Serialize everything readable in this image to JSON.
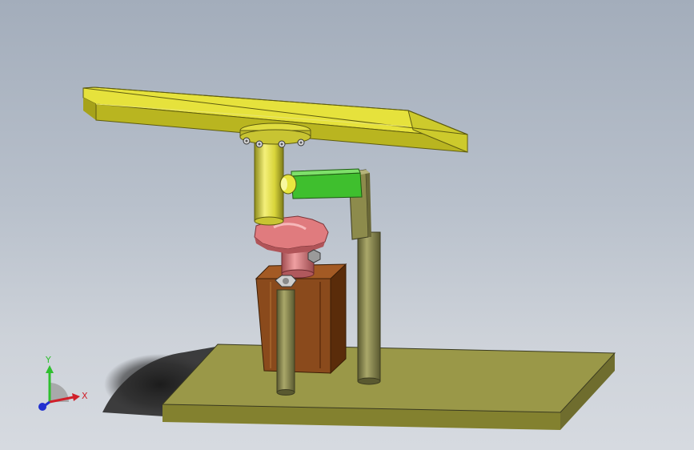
{
  "viewport": {
    "background_top": "#a3adbb",
    "background_bottom": "#d6dae0"
  },
  "model": {
    "parts": [
      {
        "name": "base-plate",
        "color": "#9a9848"
      },
      {
        "name": "top-platform",
        "color": "#e6e23c"
      },
      {
        "name": "flange-mount",
        "color": "#e0dc40"
      },
      {
        "name": "vertical-cylinder",
        "color": "#e6e23c"
      },
      {
        "name": "green-link-arm",
        "color": "#3fbf2e"
      },
      {
        "name": "side-support-post",
        "color": "#8d8b4c"
      },
      {
        "name": "star-knob",
        "color": "#e07b7e"
      },
      {
        "name": "motor-housing",
        "color": "#7a3f14"
      },
      {
        "name": "front-rod",
        "color": "#8d8b4c"
      }
    ]
  },
  "triad": {
    "x_label": "X",
    "y_label": "Y",
    "x_color": "#d0202a",
    "y_color": "#2fbf2f",
    "z_color": "#2030d0"
  }
}
